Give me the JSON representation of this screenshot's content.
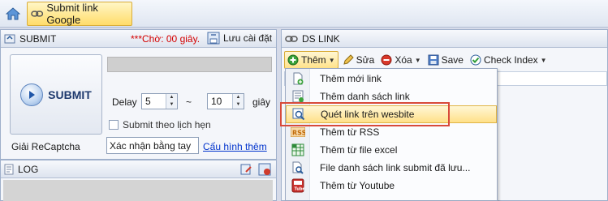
{
  "topbar": {
    "home_icon": "home-icon",
    "active_tab": {
      "label": "Submit link Google",
      "icon": "link-icon"
    }
  },
  "submit_panel": {
    "title": "SUBMIT",
    "wait_text": "***Chờ: 00 giây.",
    "save_settings_label": "Lưu cài đặt",
    "submit_button_label": "SUBMIT",
    "delay_label": "Delay",
    "delay_from": "5",
    "delay_separator": "~",
    "delay_to": "10",
    "delay_unit": "giây",
    "schedule_checkbox_label": "Submit theo lịch hẹn",
    "schedule_checked": false,
    "captcha_label": "Giải ReCaptcha",
    "captcha_value": "Xác nhận bằng tay",
    "config_link": "Cấu hình thêm"
  },
  "log_panel": {
    "title": "LOG"
  },
  "dslink_panel": {
    "title": "DS LINK",
    "toolbar": {
      "add_label": "Thêm",
      "edit_label": "Sửa",
      "delete_label": "Xóa",
      "save_label": "Save",
      "check_index_label": "Check Index"
    }
  },
  "add_menu": {
    "items": [
      {
        "label": "Thêm mới link",
        "icon": "add-page-icon"
      },
      {
        "label": "Thêm danh sách link",
        "icon": "list-add-icon"
      },
      {
        "label": "Quét link trên wesbite",
        "icon": "scan-icon"
      },
      {
        "label": "Thêm từ RSS",
        "icon": "rss-icon"
      },
      {
        "label": "Thêm từ file excel",
        "icon": "excel-icon"
      },
      {
        "label": "File danh sách link submit đã lưu...",
        "icon": "search-file-icon"
      },
      {
        "label": "Thêm từ Youtube",
        "icon": "youtube-icon"
      }
    ],
    "hover_index": 2
  },
  "colors": {
    "wait_text": "#d40000",
    "highlight_border": "#d84a3a",
    "active_tab": "#ffdc6a"
  }
}
